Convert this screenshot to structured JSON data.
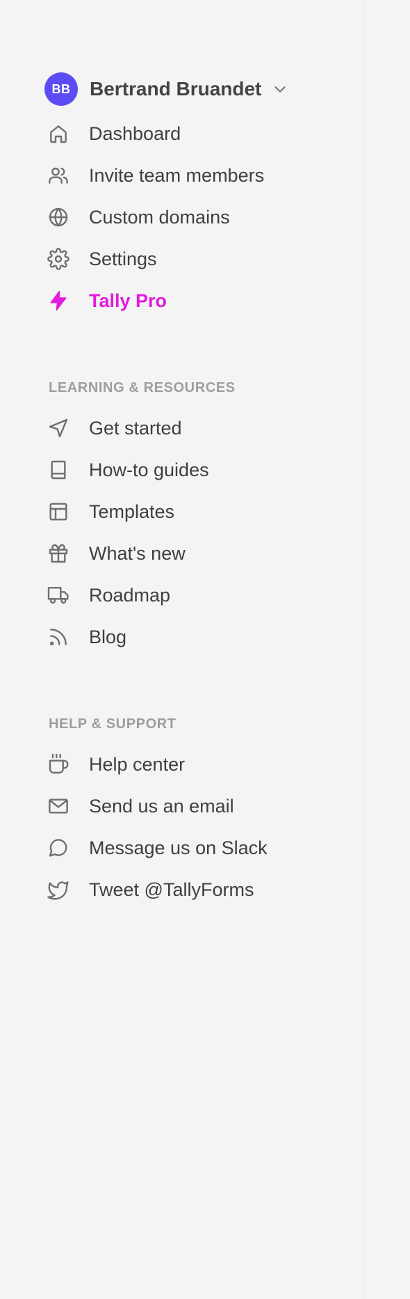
{
  "account": {
    "initials": "BB",
    "name": "Bertrand Bruandet",
    "avatar_color": "#5b4cf5"
  },
  "main_nav": [
    {
      "label": "Dashboard",
      "icon": "home-icon"
    },
    {
      "label": "Invite team members",
      "icon": "users-icon"
    },
    {
      "label": "Custom domains",
      "icon": "globe-icon"
    },
    {
      "label": "Settings",
      "icon": "gear-icon"
    },
    {
      "label": "Tally Pro",
      "icon": "lightning-icon",
      "color": "#e21bdc"
    }
  ],
  "learning": {
    "heading": "LEARNING & RESOURCES",
    "items": [
      {
        "label": "Get started",
        "icon": "send-icon"
      },
      {
        "label": "How-to guides",
        "icon": "book-icon"
      },
      {
        "label": "Templates",
        "icon": "layout-icon"
      },
      {
        "label": "What's new",
        "icon": "gift-icon"
      },
      {
        "label": "Roadmap",
        "icon": "truck-icon"
      },
      {
        "label": "Blog",
        "icon": "rss-icon"
      }
    ]
  },
  "support": {
    "heading": "HELP & SUPPORT",
    "items": [
      {
        "label": "Help center",
        "icon": "coffee-icon"
      },
      {
        "label": "Send us an email",
        "icon": "mail-icon"
      },
      {
        "label": "Message us on Slack",
        "icon": "message-circle-icon"
      },
      {
        "label": "Tweet @TallyForms",
        "icon": "twitter-icon"
      }
    ]
  }
}
